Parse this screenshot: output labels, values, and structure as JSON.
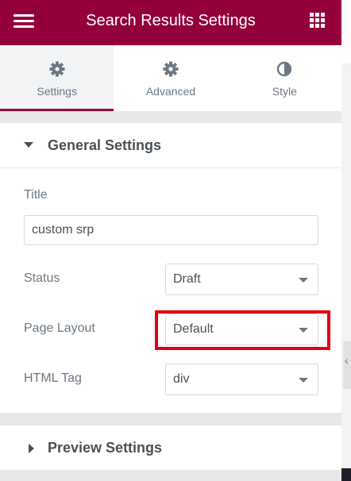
{
  "header": {
    "title": "Search Results Settings",
    "background": "#93003c"
  },
  "tabs": [
    {
      "label": "Settings",
      "icon": "gear-icon",
      "active": true
    },
    {
      "label": "Advanced",
      "icon": "gear-icon",
      "active": false
    },
    {
      "label": "Style",
      "icon": "half-circle-icon",
      "active": false
    }
  ],
  "general_settings": {
    "heading": "General Settings",
    "title_label": "Title",
    "title_value": "custom srp",
    "status_label": "Status",
    "status_value": "Draft",
    "page_layout_label": "Page Layout",
    "page_layout_value": "Default",
    "html_tag_label": "HTML Tag",
    "html_tag_value": "div"
  },
  "preview_settings": {
    "heading": "Preview Settings"
  },
  "colors": {
    "accent": "#93003c",
    "highlight_border": "#e3000f"
  }
}
